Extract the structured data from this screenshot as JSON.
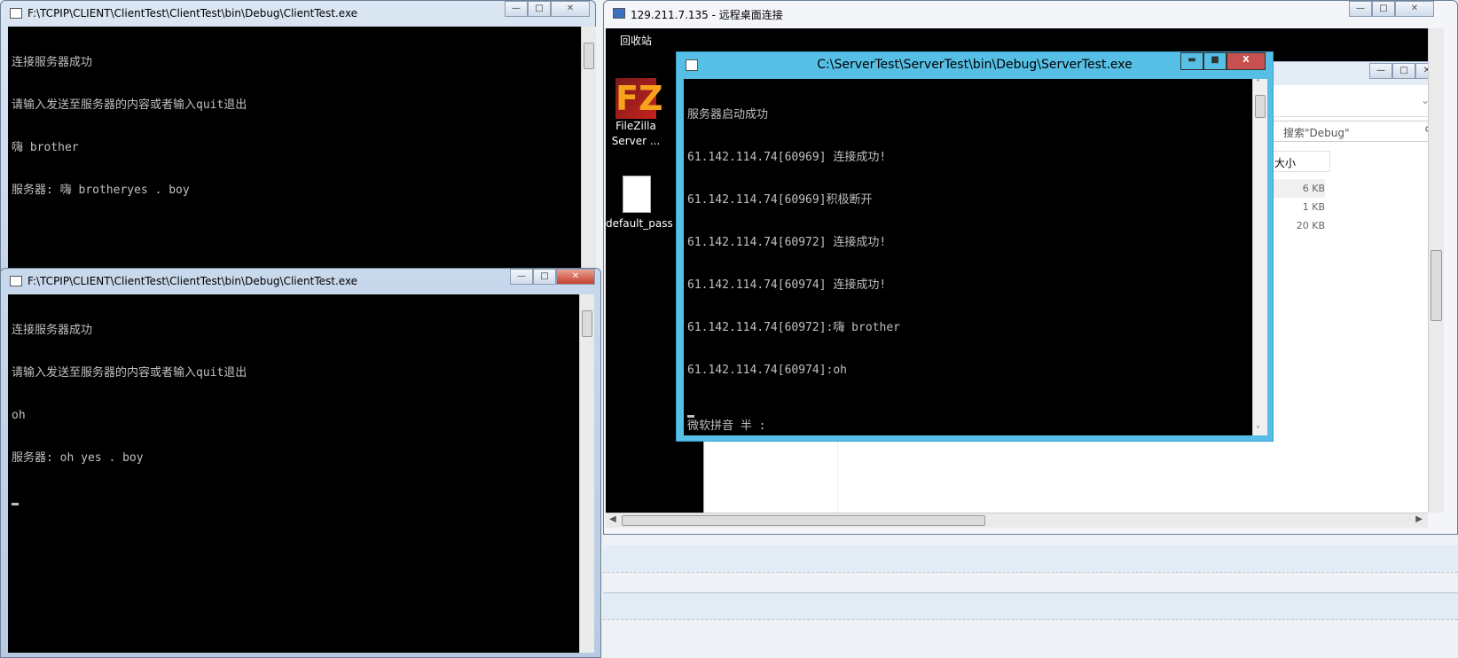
{
  "client_top": {
    "title": "F:\\TCPIP\\CLIENT\\ClientTest\\ClientTest\\bin\\Debug\\ClientTest.exe",
    "lines": [
      "连接服务器成功",
      "请输入发送至服务器的内容或者输入quit退出",
      "嗨 brother",
      "服务器: 嗨 brotheryes . boy"
    ]
  },
  "client_bottom": {
    "title": "F:\\TCPIP\\CLIENT\\ClientTest\\ClientTest\\bin\\Debug\\ClientTest.exe",
    "lines": [
      "连接服务器成功",
      "请输入发送至服务器的内容或者输入quit退出",
      "oh",
      "服务器: oh yes . boy"
    ]
  },
  "remote": {
    "title": "129.211.7.135 - 远程桌面连接",
    "desktop_icons": [
      {
        "label": "回收站"
      },
      {
        "label": "FileZilla",
        "label2": "Server ..."
      },
      {
        "label": "default_pass"
      }
    ],
    "explorer": {
      "search_placeholder": "搜索\"Debug\"",
      "column_size": "大小",
      "sizes": [
        "6 KB",
        "1 KB",
        "20 KB"
      ]
    },
    "server": {
      "title": "C:\\ServerTest\\ServerTest\\bin\\Debug\\ServerTest.exe",
      "lines": [
        "服务器启动成功",
        "61.142.114.74[60969] 连接成功!",
        "61.142.114.74[60969]积极断开",
        "61.142.114.74[60972] 连接成功!",
        "61.142.114.74[60974] 连接成功!",
        "61.142.114.74[60972]:嗨 brother",
        "61.142.114.74[60974]:oh"
      ],
      "ime_status": "微软拼音 半 :"
    }
  },
  "colors": {
    "server_border": "#55bfe6",
    "close_red": "#c75050",
    "console_bg": "#000000"
  }
}
